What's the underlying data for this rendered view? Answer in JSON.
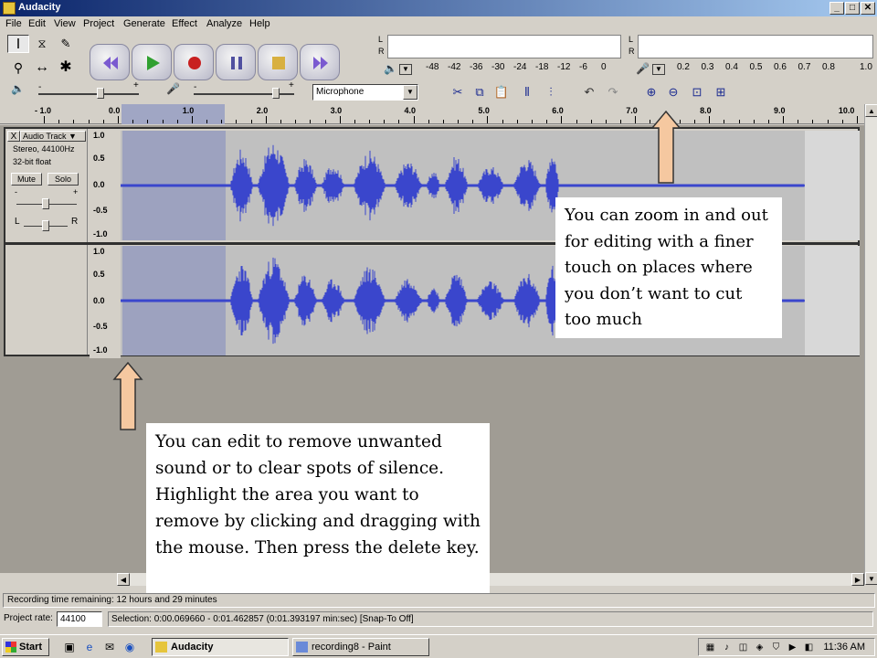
{
  "window": {
    "title": "Audacity",
    "min": "_",
    "max": "□",
    "close": "✕"
  },
  "menu": [
    "File",
    "Edit",
    "View",
    "Project",
    "Generate",
    "Effect",
    "Analyze",
    "Help"
  ],
  "meters": {
    "left_channel": "L",
    "right_channel": "R",
    "playback_scale": [
      "-48",
      "-42",
      "-36",
      "-30",
      "-24",
      "-18",
      "-12",
      "-6",
      "0"
    ],
    "record_scale": [
      "0.2",
      "0.3",
      "0.4",
      "0.5",
      "0.6",
      "0.7",
      "0.8",
      "1.0"
    ]
  },
  "mixer": {
    "minus": "-",
    "plus": "+",
    "input_source": "Microphone",
    "playback_volume": 0.62,
    "record_volume": 0.82
  },
  "ruler": {
    "labels": [
      "- 1.0",
      "0.0",
      "1.0",
      "2.0",
      "3.0",
      "4.0",
      "5.0",
      "6.0",
      "7.0",
      "8.0",
      "9.0",
      "10.0"
    ]
  },
  "track": {
    "close": "X",
    "name": "Audio Track ▼",
    "format": "Stereo, 44100Hz",
    "bit_depth": "32-bit float",
    "mute_label": "Mute",
    "solo_label": "Solo",
    "gain_minus": "-",
    "gain_plus": "+",
    "pan_left": "L",
    "pan_right": "R",
    "scale_labels": [
      "1.0",
      "0.5",
      "0.0",
      "-0.5",
      "-1.0"
    ]
  },
  "status": {
    "recording_time": "Recording time remaining: 12 hours and 29 minutes",
    "project_rate_label": "Project rate:",
    "project_rate": "44100",
    "selection": "Selection: 0:00.069660 - 0:01.462857 (0:01.393197 min:sec)  [Snap-To Off]"
  },
  "taskbar": {
    "start": "Start",
    "tasks": [
      {
        "label": "Audacity",
        "active": true
      },
      {
        "label": "recording8 - Paint",
        "active": false
      }
    ],
    "clock": "11:36 AM"
  },
  "annotations": {
    "zoom_note": "You can zoom in and out for editing with a finer touch on places where you don’t want to cut too much",
    "edit_note": "You can edit to remove unwanted sound or to clear spots of silence. Highlight the area you want to remove by clicking and dragging with the mouse.  Then press the delete key."
  },
  "colors": {
    "waveform": "#3a46cc",
    "selection": "#9da2bf",
    "title_bar": "#0a246a",
    "arrow_fill": "#f5c8a0"
  }
}
